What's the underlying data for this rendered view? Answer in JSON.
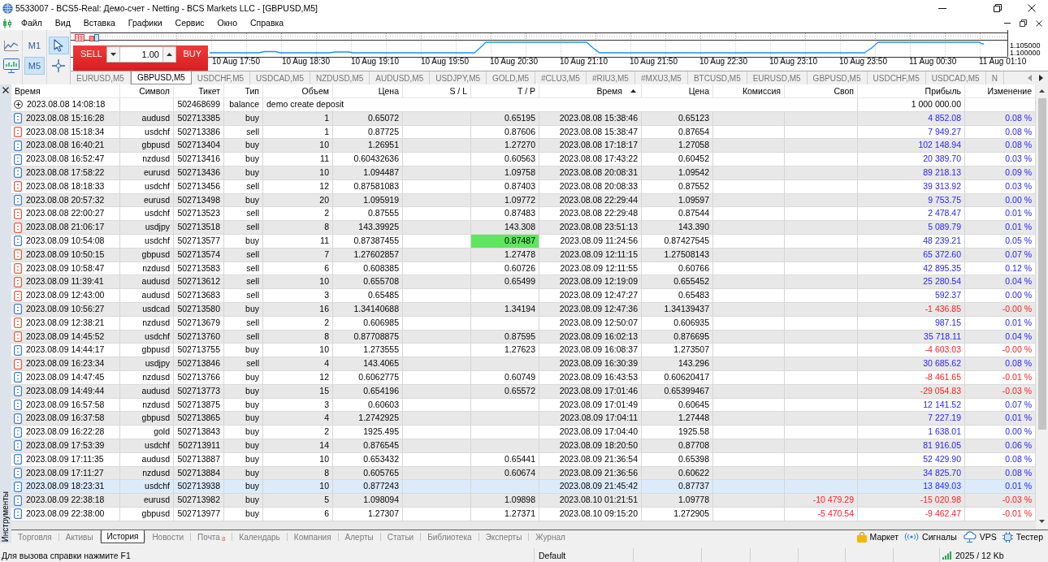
{
  "window": {
    "title": "5533007 - BCS5-Real: Демо-счет - Netting - BCS Markets LLC - [GBPUSD,M5]"
  },
  "menu": [
    "Файл",
    "Вид",
    "Вставка",
    "Графики",
    "Сервис",
    "Окно",
    "Справка"
  ],
  "toolbar": {
    "timeframes": [
      {
        "label": "M1",
        "selected": false
      },
      {
        "label": "M5",
        "selected": true
      }
    ],
    "tools": [
      {
        "kind": "cursor",
        "selected": true
      },
      {
        "kind": "crosshair",
        "selected": false
      }
    ]
  },
  "chart": {
    "sell_label": "SELL",
    "buy_label": "BUY",
    "volume": "1.00",
    "time_labels": [
      "10 Aug 17:50",
      "10 Aug 18:30",
      "10 Aug 19:10",
      "10 Aug 19:50",
      "10 Aug 20:30",
      "10 Aug 21:10",
      "10 Aug 21:50",
      "10 Aug 22:30",
      "10 Aug 23:10",
      "10 Aug 23:50",
      "11 Aug 00:30",
      "11 Aug 01:10"
    ],
    "price_labels": [
      "1.105000",
      "1.100000"
    ]
  },
  "chart_tabs": [
    {
      "label": "EURUSD,M5",
      "selected": false
    },
    {
      "label": "GBPUSD,M5",
      "selected": true
    },
    {
      "label": "USDCHF,M5",
      "selected": false
    },
    {
      "label": "USDCAD,M5",
      "selected": false
    },
    {
      "label": "NZDUSD,M5",
      "selected": false
    },
    {
      "label": "AUDUSD,M5",
      "selected": false
    },
    {
      "label": "USDJPY,M5",
      "selected": false
    },
    {
      "label": "GOLD,M5",
      "selected": false
    },
    {
      "label": "#CLU3,M5",
      "selected": false
    },
    {
      "label": "#RIU3,M5",
      "selected": false
    },
    {
      "label": "#MXU3,M5",
      "selected": false
    },
    {
      "label": "BTCUSD,M5",
      "selected": false
    },
    {
      "label": "EURUSD,M5",
      "selected": false
    },
    {
      "label": "GBPUSD,M5",
      "selected": false
    },
    {
      "label": "USDCHF,M5",
      "selected": false
    },
    {
      "label": "USDCAD,M5",
      "selected": false
    },
    {
      "label": "N",
      "selected": false
    }
  ],
  "toolbox": {
    "title": "Инструменты",
    "columns": [
      {
        "label": "Время",
        "sorted": false
      },
      {
        "label": "Символ",
        "sorted": false
      },
      {
        "label": "Тикет",
        "sorted": false
      },
      {
        "label": "Тип",
        "sorted": false
      },
      {
        "label": "Объем",
        "sorted": false
      },
      {
        "label": "Цена",
        "sorted": false
      },
      {
        "label": "S / L",
        "sorted": false
      },
      {
        "label": "T / P",
        "sorted": false
      },
      {
        "label": "Время",
        "sorted": true
      },
      {
        "label": "Цена",
        "sorted": false
      },
      {
        "label": "Комиссия",
        "sorted": false
      },
      {
        "label": "Своп",
        "sorted": false
      },
      {
        "label": "Прибыль",
        "sorted": false
      },
      {
        "label": "Изменение",
        "sorted": false
      }
    ],
    "rows": [
      {
        "kind": "balance",
        "time": "2023.08.08 14:08:18",
        "ticket": "502468699",
        "type": "balance",
        "comment": "demo create deposit",
        "profit": "1 000 000.00",
        "loss": false,
        "selected": false
      },
      {
        "kind": "buy",
        "time": "2023.08.08 15:16:28",
        "symbol": "audusd",
        "ticket": "502713385",
        "type": "buy",
        "volume": "1",
        "price": "0.65072",
        "tp": "0.65195",
        "close_time": "2023.08.08 15:38:46",
        "close_price": "0.65123",
        "profit": "4 852.08",
        "change": "0.08 %",
        "loss": false,
        "tp_hit": false,
        "selected": false
      },
      {
        "kind": "sell",
        "time": "2023.08.08 15:18:34",
        "symbol": "usdchf",
        "ticket": "502713386",
        "type": "sell",
        "volume": "1",
        "price": "0.87725",
        "tp": "0.87606",
        "close_time": "2023.08.08 15:38:47",
        "close_price": "0.87654",
        "profit": "7 949.27",
        "change": "0.08 %",
        "loss": false,
        "tp_hit": false,
        "selected": false
      },
      {
        "kind": "buy",
        "time": "2023.08.08 16:40:21",
        "symbol": "gbpusd",
        "ticket": "502713404",
        "type": "buy",
        "volume": "10",
        "price": "1.26951",
        "tp": "1.27270",
        "close_time": "2023.08.08 17:18:17",
        "close_price": "1.27058",
        "profit": "102 148.94",
        "change": "0.08 %",
        "loss": false,
        "tp_hit": false,
        "selected": false
      },
      {
        "kind": "buy",
        "time": "2023.08.08 16:52:47",
        "symbol": "nzdusd",
        "ticket": "502713416",
        "type": "buy",
        "volume": "11",
        "price": "0.60432636",
        "tp": "0.60563",
        "close_time": "2023.08.08 17:43:22",
        "close_price": "0.60452",
        "profit": "20 389.70",
        "change": "0.03 %",
        "loss": false,
        "tp_hit": false,
        "selected": false
      },
      {
        "kind": "buy",
        "time": "2023.08.08 17:58:22",
        "symbol": "eurusd",
        "ticket": "502713436",
        "type": "buy",
        "volume": "10",
        "price": "1.094487",
        "tp": "1.09758",
        "close_time": "2023.08.08 20:08:31",
        "close_price": "1.09542",
        "profit": "89 218.13",
        "change": "0.09 %",
        "loss": false,
        "tp_hit": false,
        "selected": false
      },
      {
        "kind": "sell",
        "time": "2023.08.08 18:18:33",
        "symbol": "usdchf",
        "ticket": "502713456",
        "type": "sell",
        "volume": "12",
        "price": "0.87581083",
        "tp": "0.87403",
        "close_time": "2023.08.08 20:08:33",
        "close_price": "0.87552",
        "profit": "39 313.92",
        "change": "0.03 %",
        "loss": false,
        "tp_hit": false,
        "selected": false
      },
      {
        "kind": "buy",
        "time": "2023.08.08 20:57:32",
        "symbol": "eurusd",
        "ticket": "502713498",
        "type": "buy",
        "volume": "20",
        "price": "1.095919",
        "tp": "1.09772",
        "close_time": "2023.08.08 22:29:44",
        "close_price": "1.09597",
        "profit": "9 753.75",
        "change": "0.00 %",
        "loss": false,
        "tp_hit": false,
        "selected": false
      },
      {
        "kind": "sell",
        "time": "2023.08.08 22:00:27",
        "symbol": "usdchf",
        "ticket": "502713523",
        "type": "sell",
        "volume": "2",
        "price": "0.87555",
        "tp": "0.87483",
        "close_time": "2023.08.08 22:29:48",
        "close_price": "0.87544",
        "profit": "2 478.47",
        "change": "0.01 %",
        "loss": false,
        "tp_hit": false,
        "selected": false
      },
      {
        "kind": "sell",
        "time": "2023.08.08 21:06:17",
        "symbol": "usdjpy",
        "ticket": "502713518",
        "type": "sell",
        "volume": "8",
        "price": "143.39925",
        "tp": "143.308",
        "close_time": "2023.08.08 23:51:13",
        "close_price": "143.390",
        "profit": "5 089.79",
        "change": "0.01 %",
        "loss": false,
        "tp_hit": false,
        "selected": false
      },
      {
        "kind": "buy",
        "time": "2023.08.09 10:54:08",
        "symbol": "usdchf",
        "ticket": "502713577",
        "type": "buy",
        "volume": "11",
        "price": "0.87387455",
        "tp": "0.87487",
        "close_time": "2023.08.09 11:24:56",
        "close_price": "0.87427545",
        "profit": "48 239.21",
        "change": "0.05 %",
        "loss": false,
        "tp_hit": true,
        "selected": false
      },
      {
        "kind": "sell",
        "time": "2023.08.09 10:50:15",
        "symbol": "gbpusd",
        "ticket": "502713574",
        "type": "sell",
        "volume": "7",
        "price": "1.27602857",
        "tp": "1.27478",
        "close_time": "2023.08.09 12:11:15",
        "close_price": "1.27508143",
        "profit": "65 372.60",
        "change": "0.07 %",
        "loss": false,
        "tp_hit": false,
        "selected": false
      },
      {
        "kind": "sell",
        "time": "2023.08.09 10:58:47",
        "symbol": "nzdusd",
        "ticket": "502713583",
        "type": "sell",
        "volume": "6",
        "price": "0.608385",
        "tp": "0.60726",
        "close_time": "2023.08.09 12:11:55",
        "close_price": "0.60766",
        "profit": "42 895.35",
        "change": "0.12 %",
        "loss": false,
        "tp_hit": false,
        "selected": false
      },
      {
        "kind": "sell",
        "time": "2023.08.09 11:39:41",
        "symbol": "audusd",
        "ticket": "502713612",
        "type": "sell",
        "volume": "10",
        "price": "0.655708",
        "tp": "0.65499",
        "close_time": "2023.08.09 12:19:09",
        "close_price": "0.655452",
        "profit": "25 280.54",
        "change": "0.04 %",
        "loss": false,
        "tp_hit": false,
        "selected": false
      },
      {
        "kind": "sell",
        "time": "2023.08.09 12:43:00",
        "symbol": "audusd",
        "ticket": "502713683",
        "type": "sell",
        "volume": "3",
        "price": "0.65485",
        "close_time": "2023.08.09 12:47:27",
        "close_price": "0.65483",
        "profit": "592.37",
        "change": "0.00 %",
        "loss": false,
        "tp_hit": false,
        "selected": false
      },
      {
        "kind": "buy",
        "time": "2023.08.09 10:56:27",
        "symbol": "usdcad",
        "ticket": "502713580",
        "type": "buy",
        "volume": "16",
        "price": "1.34140688",
        "tp": "1.34194",
        "close_time": "2023.08.09 12:47:36",
        "close_price": "1.34139437",
        "profit": "-1 436.85",
        "change": "-0.00 %",
        "loss": true,
        "tp_hit": false,
        "selected": false
      },
      {
        "kind": "sell",
        "time": "2023.08.09 12:38:21",
        "symbol": "nzdusd",
        "ticket": "502713679",
        "type": "sell",
        "volume": "2",
        "price": "0.606985",
        "close_time": "2023.08.09 12:50:07",
        "close_price": "0.606935",
        "profit": "987.15",
        "change": "0.01 %",
        "loss": false,
        "tp_hit": false,
        "selected": false
      },
      {
        "kind": "sell",
        "time": "2023.08.09 14:45:52",
        "symbol": "usdchf",
        "ticket": "502713760",
        "type": "sell",
        "volume": "8",
        "price": "0.87708875",
        "tp": "0.87595",
        "close_time": "2023.08.09 16:02:13",
        "close_price": "0.876695",
        "profit": "35 718.11",
        "change": "0.04 %",
        "loss": false,
        "tp_hit": false,
        "selected": false
      },
      {
        "kind": "buy",
        "time": "2023.08.09 14:44:17",
        "symbol": "gbpusd",
        "ticket": "502713755",
        "type": "buy",
        "volume": "10",
        "price": "1.273555",
        "tp": "1.27623",
        "close_time": "2023.08.09 16:08:37",
        "close_price": "1.273507",
        "profit": "-4 603.03",
        "change": "-0.00 %",
        "loss": true,
        "tp_hit": false,
        "selected": false
      },
      {
        "kind": "sell",
        "time": "2023.08.09 16:23:34",
        "symbol": "usdjpy",
        "ticket": "502713846",
        "type": "sell",
        "volume": "4",
        "price": "143.4065",
        "close_time": "2023.08.09 16:30:39",
        "close_price": "143.296",
        "profit": "30 685.62",
        "change": "0.08 %",
        "loss": false,
        "tp_hit": false,
        "selected": false
      },
      {
        "kind": "buy",
        "time": "2023.08.09 14:47:45",
        "symbol": "nzdusd",
        "ticket": "502713766",
        "type": "buy",
        "volume": "12",
        "price": "0.6062775",
        "tp": "0.60749",
        "close_time": "2023.08.09 16:43:53",
        "close_price": "0.60620417",
        "profit": "-8 461.65",
        "change": "-0.01 %",
        "loss": true,
        "tp_hit": false,
        "selected": false
      },
      {
        "kind": "buy",
        "time": "2023.08.09 14:49:44",
        "symbol": "audusd",
        "ticket": "502713773",
        "type": "buy",
        "volume": "15",
        "price": "0.654196",
        "tp": "0.65572",
        "close_time": "2023.08.09 17:01:46",
        "close_price": "0.65399467",
        "profit": "-29 054.83",
        "change": "-0.03 %",
        "loss": true,
        "tp_hit": false,
        "selected": false
      },
      {
        "kind": "buy",
        "time": "2023.08.09 16:57:58",
        "symbol": "nzdusd",
        "ticket": "502713875",
        "type": "buy",
        "volume": "3",
        "price": "0.60603",
        "close_time": "2023.08.09 17:01:49",
        "close_price": "0.60645",
        "profit": "12 141.52",
        "change": "0.07 %",
        "loss": false,
        "tp_hit": false,
        "selected": false
      },
      {
        "kind": "buy",
        "time": "2023.08.09 16:37:58",
        "symbol": "gbpusd",
        "ticket": "502713865",
        "type": "buy",
        "volume": "4",
        "price": "1.2742925",
        "close_time": "2023.08.09 17:04:11",
        "close_price": "1.27448",
        "profit": "7 227.19",
        "change": "0.01 %",
        "loss": false,
        "tp_hit": false,
        "selected": false
      },
      {
        "kind": "buy",
        "time": "2023.08.09 16:22:28",
        "symbol": "gold",
        "ticket": "502713843",
        "type": "buy",
        "volume": "2",
        "price": "1925.495",
        "close_time": "2023.08.09 17:04:40",
        "close_price": "1925.58",
        "profit": "1 638.01",
        "change": "0.00 %",
        "loss": false,
        "tp_hit": false,
        "selected": false
      },
      {
        "kind": "buy",
        "time": "2023.08.09 17:53:39",
        "symbol": "usdchf",
        "ticket": "502713911",
        "type": "buy",
        "volume": "14",
        "price": "0.876545",
        "close_time": "2023.08.09 18:20:50",
        "close_price": "0.87708",
        "profit": "81 916.05",
        "change": "0.06 %",
        "loss": false,
        "tp_hit": false,
        "selected": false
      },
      {
        "kind": "buy",
        "time": "2023.08.09 17:11:35",
        "symbol": "audusd",
        "ticket": "502713887",
        "type": "buy",
        "volume": "10",
        "price": "0.653432",
        "tp": "0.65441",
        "close_time": "2023.08.09 21:36:54",
        "close_price": "0.65398",
        "profit": "52 429.90",
        "change": "0.08 %",
        "loss": false,
        "tp_hit": false,
        "selected": false
      },
      {
        "kind": "buy",
        "time": "2023.08.09 17:11:27",
        "symbol": "nzdusd",
        "ticket": "502713884",
        "type": "buy",
        "volume": "8",
        "price": "0.605765",
        "tp": "0.60674",
        "close_time": "2023.08.09 21:36:56",
        "close_price": "0.60622",
        "profit": "34 825.70",
        "change": "0.08 %",
        "loss": false,
        "tp_hit": false,
        "selected": false
      },
      {
        "kind": "buy",
        "time": "2023.08.09 18:23:31",
        "symbol": "usdchf",
        "ticket": "502713938",
        "type": "buy",
        "volume": "10",
        "price": "0.877243",
        "close_time": "2023.08.09 21:45:42",
        "close_price": "0.87737",
        "profit": "13 849.03",
        "change": "0.01 %",
        "loss": false,
        "tp_hit": false,
        "selected": true
      },
      {
        "kind": "buy",
        "time": "2023.08.09 22:38:18",
        "symbol": "eurusd",
        "ticket": "502713982",
        "type": "buy",
        "volume": "5",
        "price": "1.098094",
        "tp": "1.09898",
        "close_time": "2023.08.10 01:21:51",
        "close_price": "1.09778",
        "swap": "-10 479.29",
        "profit": "-15 020.98",
        "change": "-0.03 %",
        "loss": true,
        "tp_hit": false,
        "selected": false
      },
      {
        "kind": "buy",
        "time": "2023.08.09 22:38:00",
        "symbol": "gbpusd",
        "ticket": "502713977",
        "type": "buy",
        "volume": "6",
        "price": "1.27307",
        "tp": "1.27371",
        "close_time": "2023.08.10 09:15:20",
        "close_price": "1.272905",
        "swap": "-5 470.54",
        "profit": "-9 462.47",
        "change": "-0.01 %",
        "loss": true,
        "tp_hit": false,
        "selected": false
      }
    ],
    "tabs": [
      {
        "label": "Торговля",
        "selected": false
      },
      {
        "label": "Активы",
        "selected": false
      },
      {
        "label": "История",
        "selected": true
      },
      {
        "label": "Новости",
        "selected": false
      },
      {
        "label": "Почта",
        "selected": false,
        "badge": "8"
      },
      {
        "label": "Календарь",
        "selected": false
      },
      {
        "label": "Компания",
        "selected": false
      },
      {
        "label": "Алерты",
        "selected": false
      },
      {
        "label": "Статьи",
        "selected": false
      },
      {
        "label": "Библиотека",
        "selected": false
      },
      {
        "label": "Эксперты",
        "selected": false
      },
      {
        "label": "Журнал",
        "selected": false
      }
    ],
    "services": [
      {
        "kind": "market",
        "label": "Маркет"
      },
      {
        "kind": "signals",
        "label": "Сигналы"
      },
      {
        "kind": "vps",
        "label": "VPS"
      },
      {
        "kind": "tester",
        "label": "Тестер"
      }
    ]
  },
  "status_bar": {
    "help": "Для вызова справки нажмите F1",
    "profile": "Default",
    "traffic": "2025 / 12 Kb"
  }
}
